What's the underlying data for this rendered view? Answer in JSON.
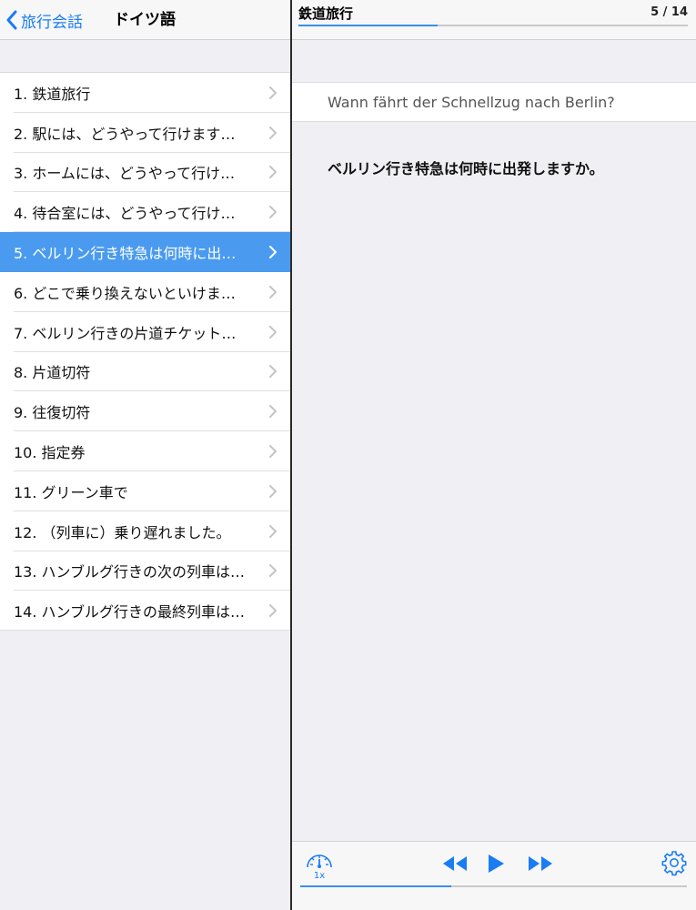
{
  "left_nav": {
    "back_label": "旅行会話",
    "title": "ドイツ語"
  },
  "list": {
    "selected_index": 4,
    "items": [
      {
        "label": "1. 鉄道旅行"
      },
      {
        "label": "2. 駅には、どうやって行けます…"
      },
      {
        "label": "3. ホームには、どうやって行け…"
      },
      {
        "label": "4. 待合室には、どうやって行け…"
      },
      {
        "label": "5. ベルリン行き特急は何時に出…"
      },
      {
        "label": "6. どこで乗り換えないといけま…"
      },
      {
        "label": "7. ベルリン行きの片道チケット…"
      },
      {
        "label": "8. 片道切符"
      },
      {
        "label": "9. 往復切符"
      },
      {
        "label": "10. 指定券"
      },
      {
        "label": "11. グリーン車で"
      },
      {
        "label": "12. （列車に）乗り遅れました。"
      },
      {
        "label": "13. ハンブルグ行きの次の列車は…"
      },
      {
        "label": "14. ハンブルグ行きの最終列車は…"
      }
    ]
  },
  "detail": {
    "title": "鉄道旅行",
    "counter": "5 / 14",
    "progress_fraction": 0.357,
    "german": "Wann fährt der Schnellzug nach Berlin?",
    "japanese": "ベルリン行き特急は何時に出発しますか。"
  },
  "player": {
    "speed_label": "1x",
    "progress_fraction": 0.39
  },
  "colors": {
    "accent": "#1a7cf3",
    "selected_row": "#4a9bf0",
    "progress": "#3a8fe6"
  }
}
